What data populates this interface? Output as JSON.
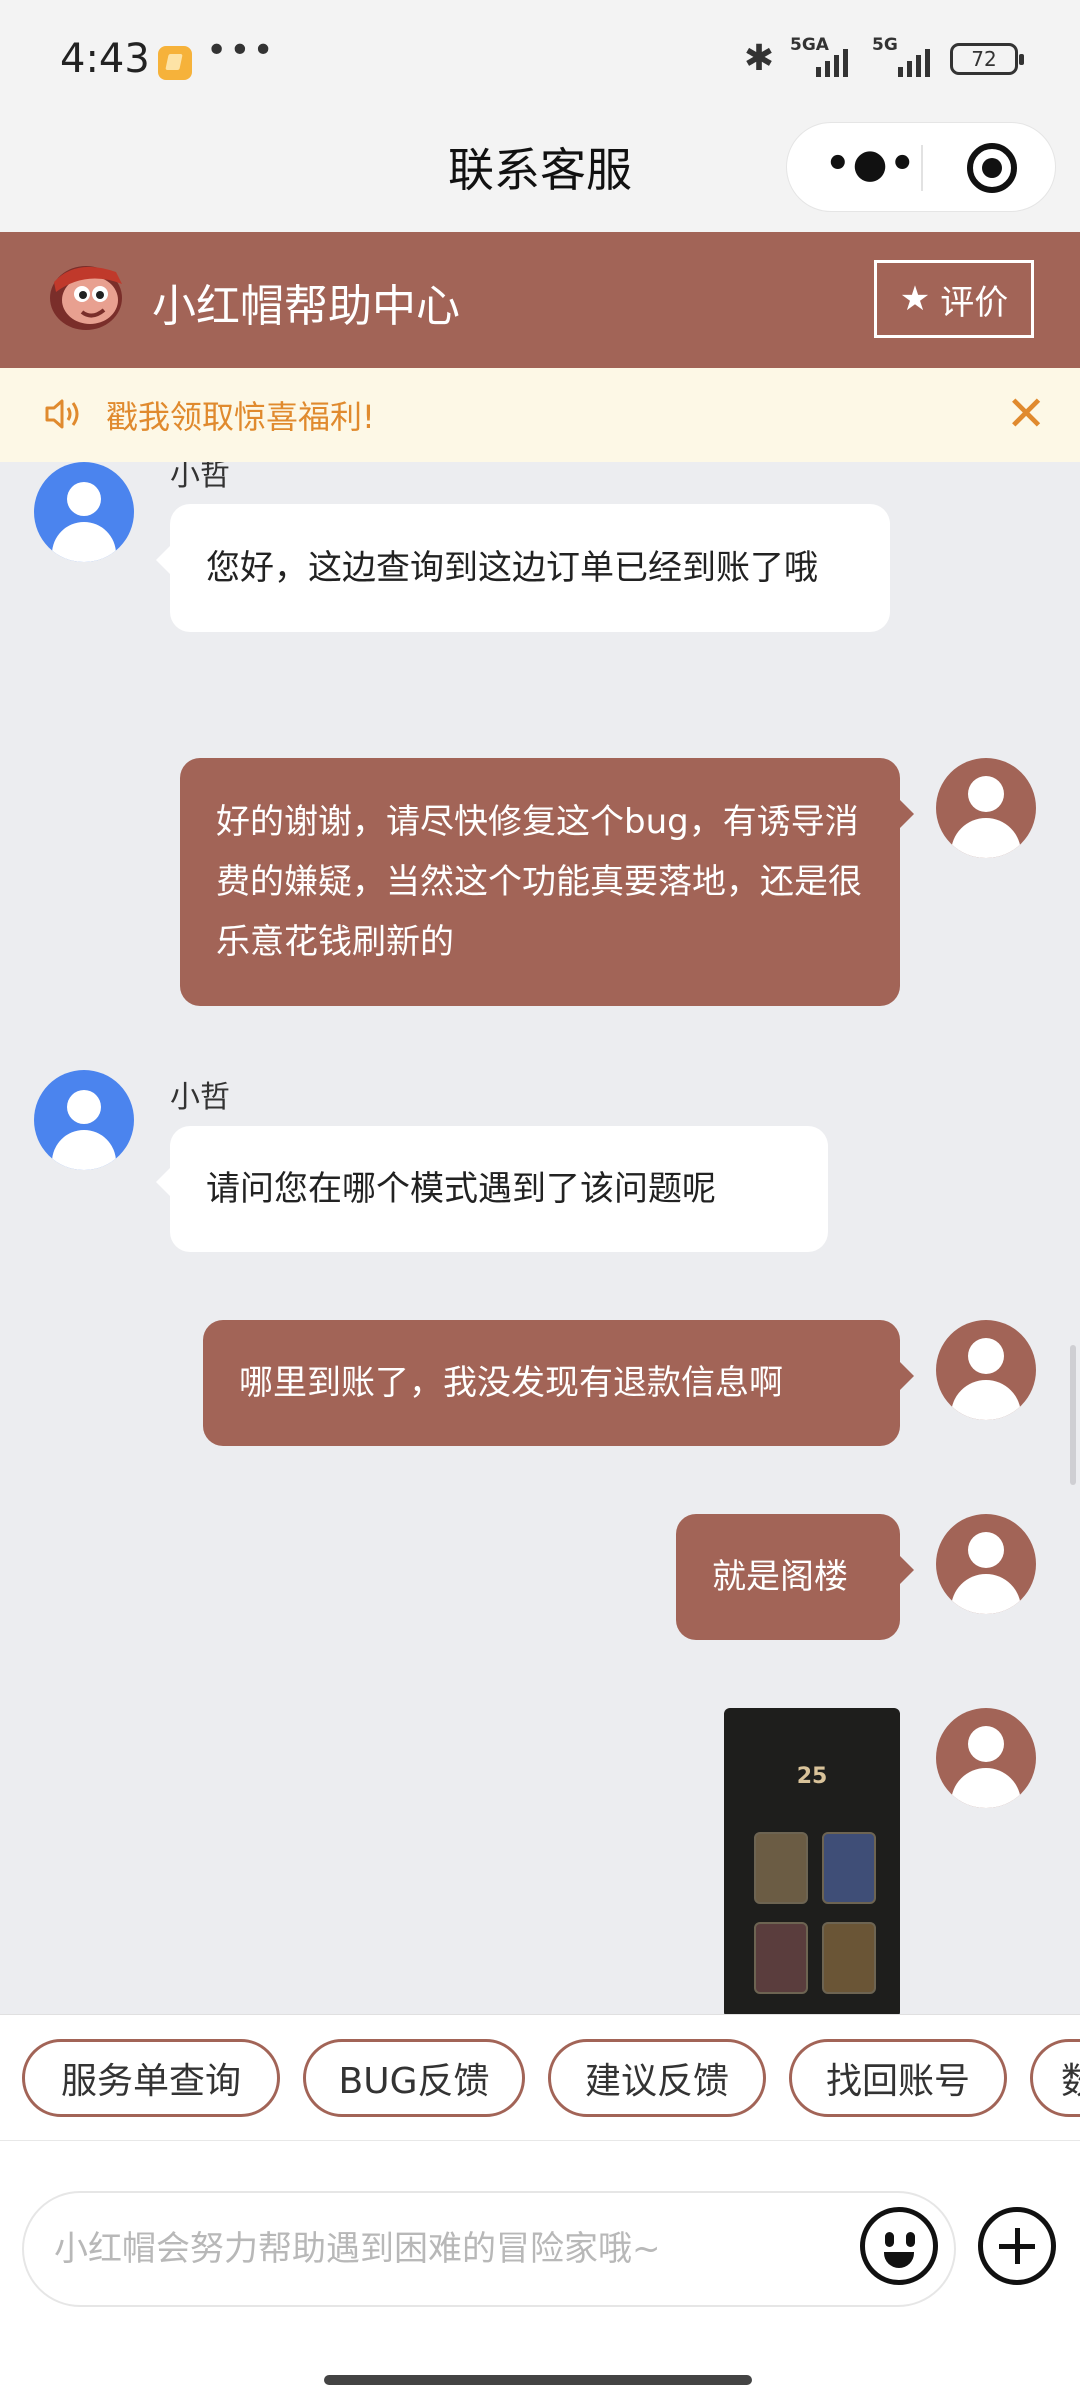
{
  "status_bar": {
    "time": "4:43",
    "signal1_label": "5GA",
    "signal2_label": "5G",
    "battery": "72"
  },
  "header": {
    "title": "联系客服"
  },
  "help_center": {
    "title": "小红帽帮助中心",
    "rate_label": "评价"
  },
  "notice": {
    "text": "戳我领取惊喜福利!"
  },
  "messages": [
    {
      "side": "agent",
      "sender": "小哲",
      "text": "您好，这边查询到这边订单已经到账了哦"
    },
    {
      "side": "user",
      "text": "好的谢谢，请尽快修复这个bug，有诱导消费的嫌疑，当然这个功能真要落地，还是很乐意花钱刷新的"
    },
    {
      "side": "agent",
      "sender": "小哲",
      "text": "请问您在哪个模式遇到了该问题呢"
    },
    {
      "side": "user",
      "text": "哪里到账了，我没发现有退款信息啊"
    },
    {
      "side": "user",
      "text": "就是阁楼"
    },
    {
      "side": "user",
      "type": "image"
    }
  ],
  "quick_replies": [
    "服务单查询",
    "BUG反馈",
    "建议反馈",
    "找回账号",
    "数"
  ],
  "input": {
    "placeholder": "小红帽会努力帮助遇到困难的冒险家哦~"
  }
}
